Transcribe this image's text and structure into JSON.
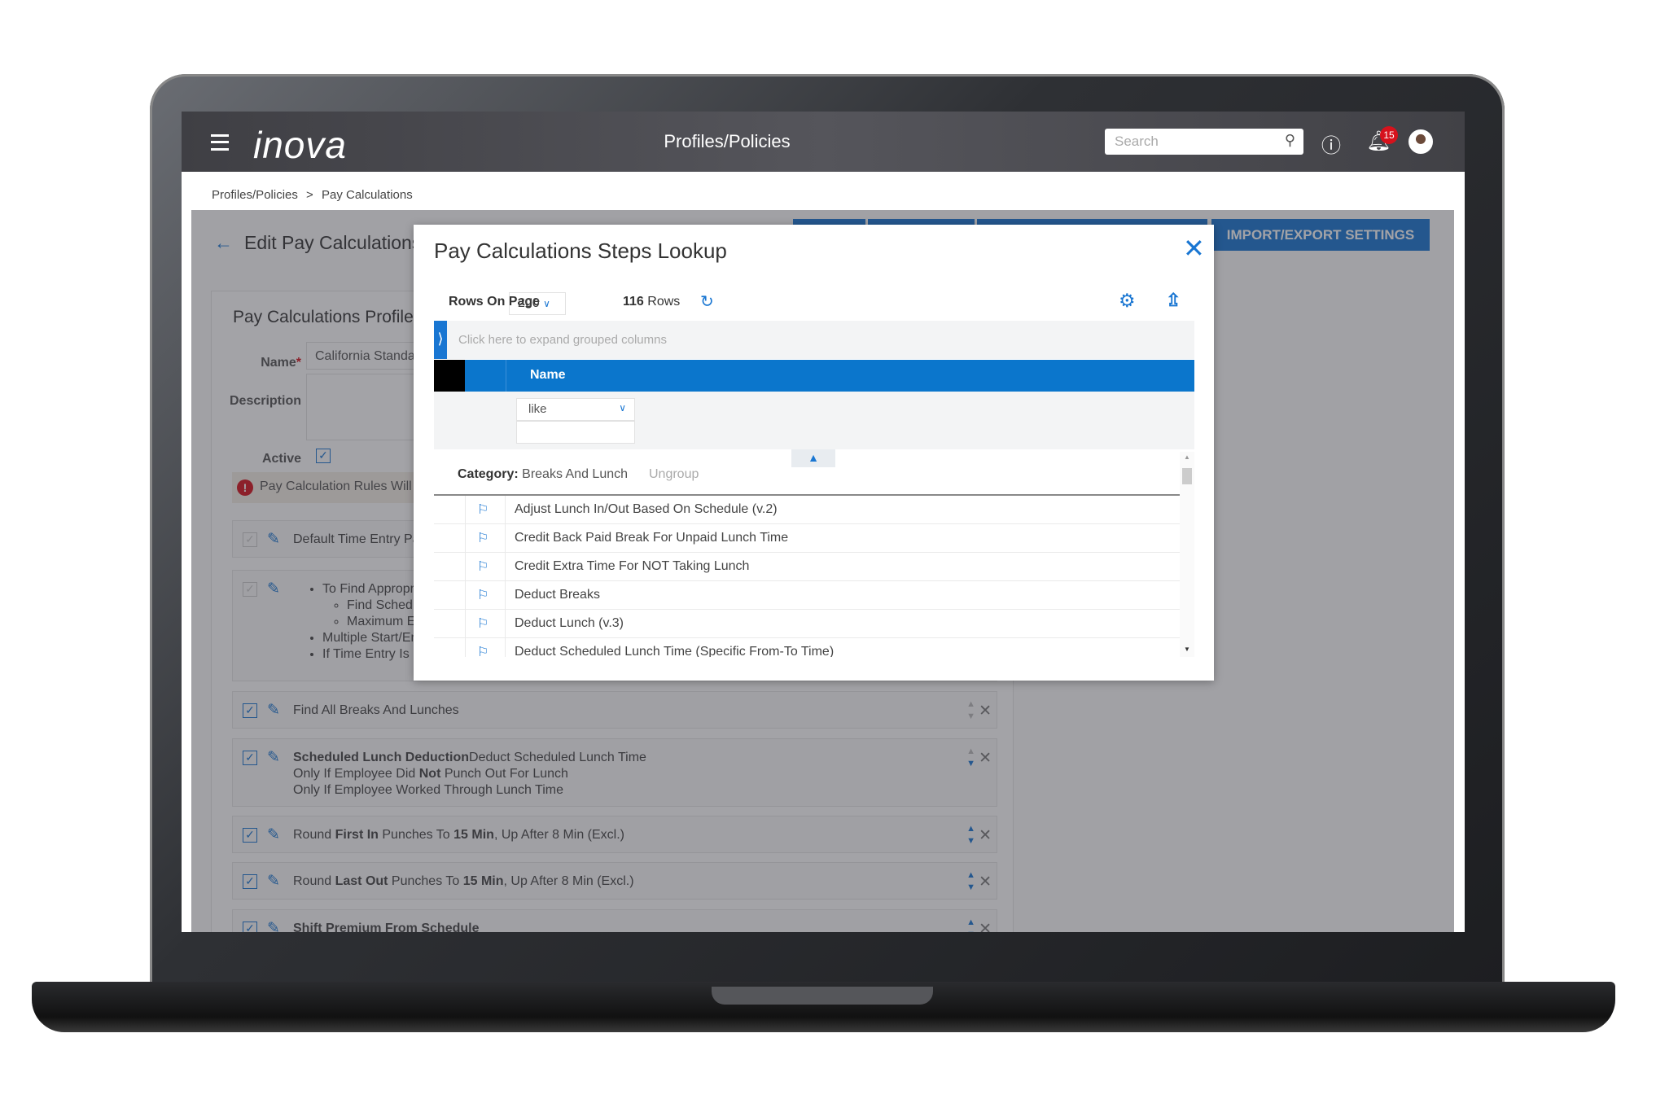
{
  "header": {
    "logo": "inova",
    "title": "Profiles/Policies",
    "search_placeholder": "Search",
    "notification_count": "15",
    "icons": [
      "menu-icon",
      "search-icon",
      "help-icon",
      "bell-icon",
      "avatar"
    ]
  },
  "breadcrumb": {
    "items": [
      "Profiles/Policies",
      "Pay Calculations"
    ],
    "separator": ">"
  },
  "page": {
    "title": "Edit Pay Calculations",
    "import_export_label": "IMPORT/EXPORT SETTINGS"
  },
  "profile": {
    "title": "Pay Calculations Profile",
    "name_label": "Name",
    "name_value": "California Standa",
    "description_label": "Description",
    "active_label": "Active",
    "active": true,
    "warning": "Pay Calculation Rules Will"
  },
  "steps": [
    {
      "text": "Default Time Entry Pa",
      "enabled": false
    },
    {
      "bullets": [
        "To Find Appropriat",
        "Find Schedule",
        "Maximum Ea",
        "Multiple Start/End",
        "If Time Entry Is Inc"
      ],
      "enabled": false
    },
    {
      "text": "Find All Breaks And Lunches",
      "enabled": true
    },
    {
      "bold": "Scheduled Lunch Deduction",
      "text": "Deduct Scheduled Lunch Time",
      "line2a": "Only If Employee Did ",
      "line2b": "Not",
      "line2c": " Punch Out For Lunch",
      "line3": "Only If Employee Worked Through Lunch Time",
      "enabled": true
    },
    {
      "p1": "Round ",
      "b1": "First In",
      "p2": " Punches To ",
      "b2": "15 Min",
      "p3": ", Up After 8 Min (Excl.)",
      "enabled": true
    },
    {
      "p1": "Round ",
      "b1": "Last Out",
      "p2": " Punches To ",
      "b2": "15 Min",
      "p3": ", Up After 8 Min (Excl.)",
      "enabled": true
    },
    {
      "bold": "Shift Premium From Schedule",
      "enabled": true
    }
  ],
  "modal": {
    "title": "Pay Calculations Steps Lookup",
    "rows_on_page_label": "Rows On Page",
    "rows_on_page": "200",
    "row_count": "116",
    "rows_label": "Rows",
    "group_hint": "Click here to expand grouped columns",
    "column": "Name",
    "filter_operator": "like",
    "filter_value": "",
    "category_label": "Category:",
    "category_value": "Breaks And Lunch",
    "ungroup_label": "Ungroup",
    "rows": [
      "Adjust Lunch In/Out Based On Schedule (v.2)",
      "Credit Back Paid Break For Unpaid Lunch Time",
      "Credit Extra Time For NOT Taking Lunch",
      "Deduct Breaks",
      "Deduct Lunch (v.3)",
      "Deduct Scheduled Lunch Time (Specific From-To Time)"
    ]
  },
  "colors": {
    "accent": "#1976d2",
    "header_blue": "#0b76cc",
    "badge": "#d6121c",
    "topbar": "#4a4a4f"
  }
}
